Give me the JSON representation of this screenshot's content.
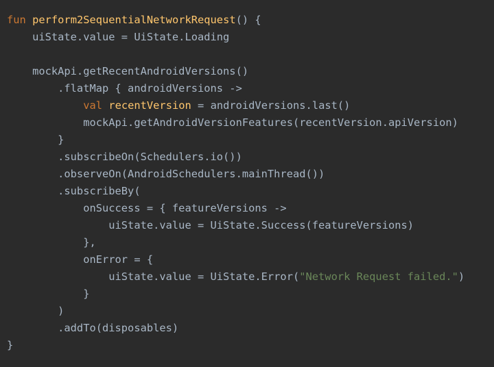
{
  "code_editor": {
    "theme_colors": {
      "background": "#2b2b2b",
      "plain": "#a9b7c6",
      "keyword": "#cc7832",
      "function": "#ffc66d",
      "string": "#6a8759"
    },
    "lines": [
      [
        {
          "t": "fun",
          "k": "keyword"
        },
        {
          "t": " ",
          "k": "plain"
        },
        {
          "t": "perform2SequentialNetworkRequest",
          "k": "function"
        },
        {
          "t": "() {",
          "k": "plain"
        }
      ],
      [
        {
          "t": "    uiState.value = UiState.Loading",
          "k": "plain"
        }
      ],
      [],
      [
        {
          "t": "    mockApi.getRecentAndroidVersions()",
          "k": "plain"
        }
      ],
      [
        {
          "t": "        .flatMap { androidVersions ->",
          "k": "plain"
        }
      ],
      [
        {
          "t": "            ",
          "k": "plain"
        },
        {
          "t": "val",
          "k": "keyword"
        },
        {
          "t": " ",
          "k": "plain"
        },
        {
          "t": "recentVersion",
          "k": "property"
        },
        {
          "t": " = androidVersions.last()",
          "k": "plain"
        }
      ],
      [
        {
          "t": "            mockApi.getAndroidVersionFeatures(recentVersion.apiVersion)",
          "k": "plain"
        }
      ],
      [
        {
          "t": "        }",
          "k": "plain"
        }
      ],
      [
        {
          "t": "        .subscribeOn(Schedulers.io())",
          "k": "plain"
        }
      ],
      [
        {
          "t": "        .observeOn(AndroidSchedulers.mainThread())",
          "k": "plain"
        }
      ],
      [
        {
          "t": "        .subscribeBy(",
          "k": "plain"
        }
      ],
      [
        {
          "t": "            onSuccess = { featureVersions ->",
          "k": "plain"
        }
      ],
      [
        {
          "t": "                uiState.value = UiState.Success(featureVersions)",
          "k": "plain"
        }
      ],
      [
        {
          "t": "            },",
          "k": "plain"
        }
      ],
      [
        {
          "t": "            onError = {",
          "k": "plain"
        }
      ],
      [
        {
          "t": "                uiState.value = UiState.Error(",
          "k": "plain"
        },
        {
          "t": "\"Network Request failed.\"",
          "k": "string"
        },
        {
          "t": ")",
          "k": "plain"
        }
      ],
      [
        {
          "t": "            }",
          "k": "plain"
        }
      ],
      [
        {
          "t": "        )",
          "k": "plain"
        }
      ],
      [
        {
          "t": "        .addTo(disposables)",
          "k": "plain"
        }
      ],
      [
        {
          "t": "}",
          "k": "plain"
        }
      ]
    ]
  }
}
